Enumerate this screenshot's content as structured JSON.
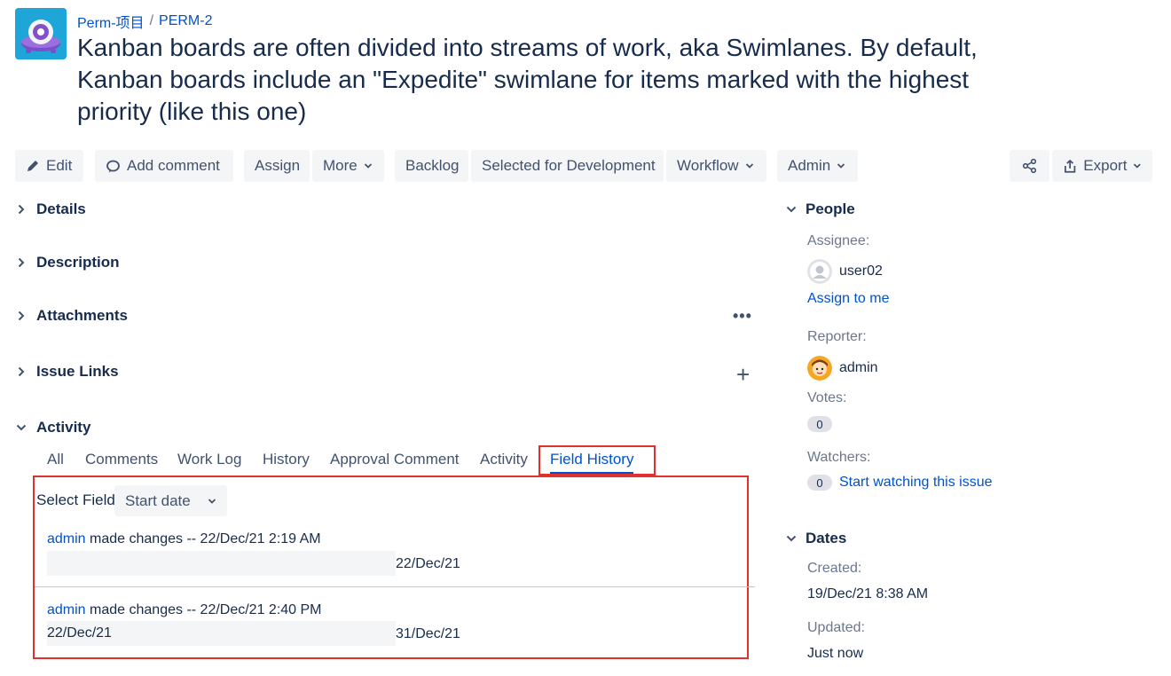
{
  "breadcrumb": {
    "project": "Perm-项目",
    "separator": "/",
    "issue_key": "PERM-2"
  },
  "issue": {
    "summary": "Kanban boards are often divided into streams of work, aka Swimlanes. By default, Kanban boards include an \"Expedite\" swimlane for items marked with the highest priority (like this one)"
  },
  "toolbar": {
    "edit": "Edit",
    "add_comment": "Add comment",
    "assign": "Assign",
    "more": "More",
    "backlog": "Backlog",
    "selected_for_development": "Selected for Development",
    "workflow": "Workflow",
    "admin": "Admin",
    "export": "Export"
  },
  "modules": {
    "details": "Details",
    "description": "Description",
    "attachments": "Attachments",
    "attachments_menu": "•••",
    "issue_links": "Issue Links",
    "issue_links_add": "+",
    "activity": "Activity"
  },
  "activity": {
    "tabs": [
      "All",
      "Comments",
      "Work Log",
      "History",
      "Approval Comment",
      "Activity",
      "Field History"
    ],
    "active_tab": "Field History",
    "select_field_label": "Select Field",
    "select_field_value": "Start date",
    "entries": [
      {
        "user": "admin",
        "action": "made changes -- 22/Dec/21 2:19 AM",
        "old_value": "",
        "new_value": "22/Dec/21"
      },
      {
        "user": "admin",
        "action": "made changes -- 22/Dec/21 2:40 PM",
        "old_value": "22/Dec/21",
        "new_value": "31/Dec/21"
      }
    ]
  },
  "people": {
    "title": "People",
    "assignee_label": "Assignee:",
    "assignee": "user02",
    "assign_to_me": "Assign to me",
    "reporter_label": "Reporter:",
    "reporter": "admin",
    "votes_label": "Votes:",
    "votes": "0",
    "watchers_label": "Watchers:",
    "watchers": "0",
    "start_watching": "Start watching this issue"
  },
  "dates": {
    "title": "Dates",
    "created_label": "Created:",
    "created": "19/Dec/21 8:38 AM",
    "updated_label": "Updated:",
    "updated": "Just now"
  },
  "colors": {
    "link": "#0052cc",
    "highlight": "#e03131",
    "text": "#172b4d",
    "button_bg": "#f4f5f7"
  }
}
